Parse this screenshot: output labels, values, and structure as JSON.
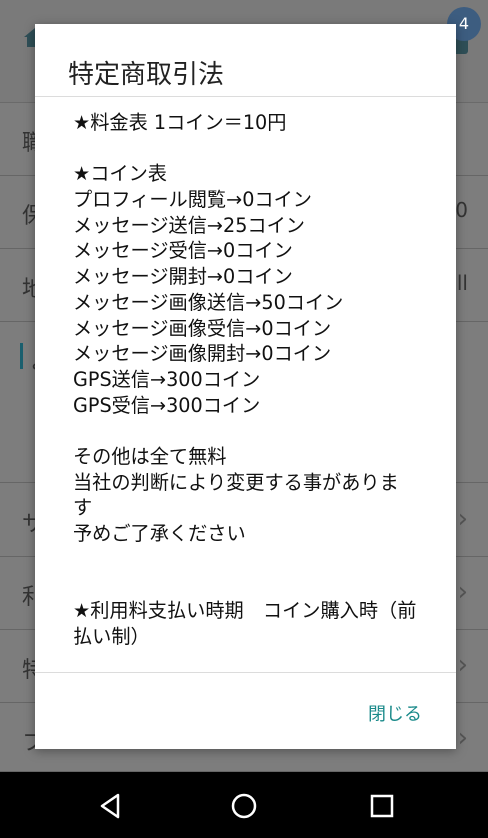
{
  "background": {
    "badge": "4",
    "rows": [
      {
        "text": "職",
        "right": ""
      },
      {
        "text": "保",
        "right": "0"
      },
      {
        "text": "地",
        "right": "ll"
      },
      {
        "text": "よ",
        "right": ""
      },
      {
        "text": "サ",
        "right": ""
      },
      {
        "text": "利",
        "right": ""
      },
      {
        "text": "特",
        "right": ""
      },
      {
        "text": "フ",
        "right": ""
      }
    ]
  },
  "dialog": {
    "title": "特定商取引法",
    "body_lines": [
      "★料金表 1コイン＝10円",
      "",
      "★コイン表",
      "プロフィール閲覧→0コイン",
      "メッセージ送信→25コイン",
      "メッセージ受信→0コイン",
      "メッセージ開封→0コイン",
      "メッセージ画像送信→50コイン",
      "メッセージ画像受信→0コイン",
      "メッセージ画像開封→0コイン",
      "GPS送信→300コイン",
      "GPS受信→300コイン",
      "",
      "その他は全て無料",
      "当社の判断により変更する事がありま す",
      "予めご了承ください",
      "",
      "",
      "★利用料支払い時期　コイン購入時（前払い制）"
    ],
    "close_label": "閉じる"
  },
  "colors": {
    "accent": "#1a8a8a",
    "badge": "#3d5d80"
  }
}
